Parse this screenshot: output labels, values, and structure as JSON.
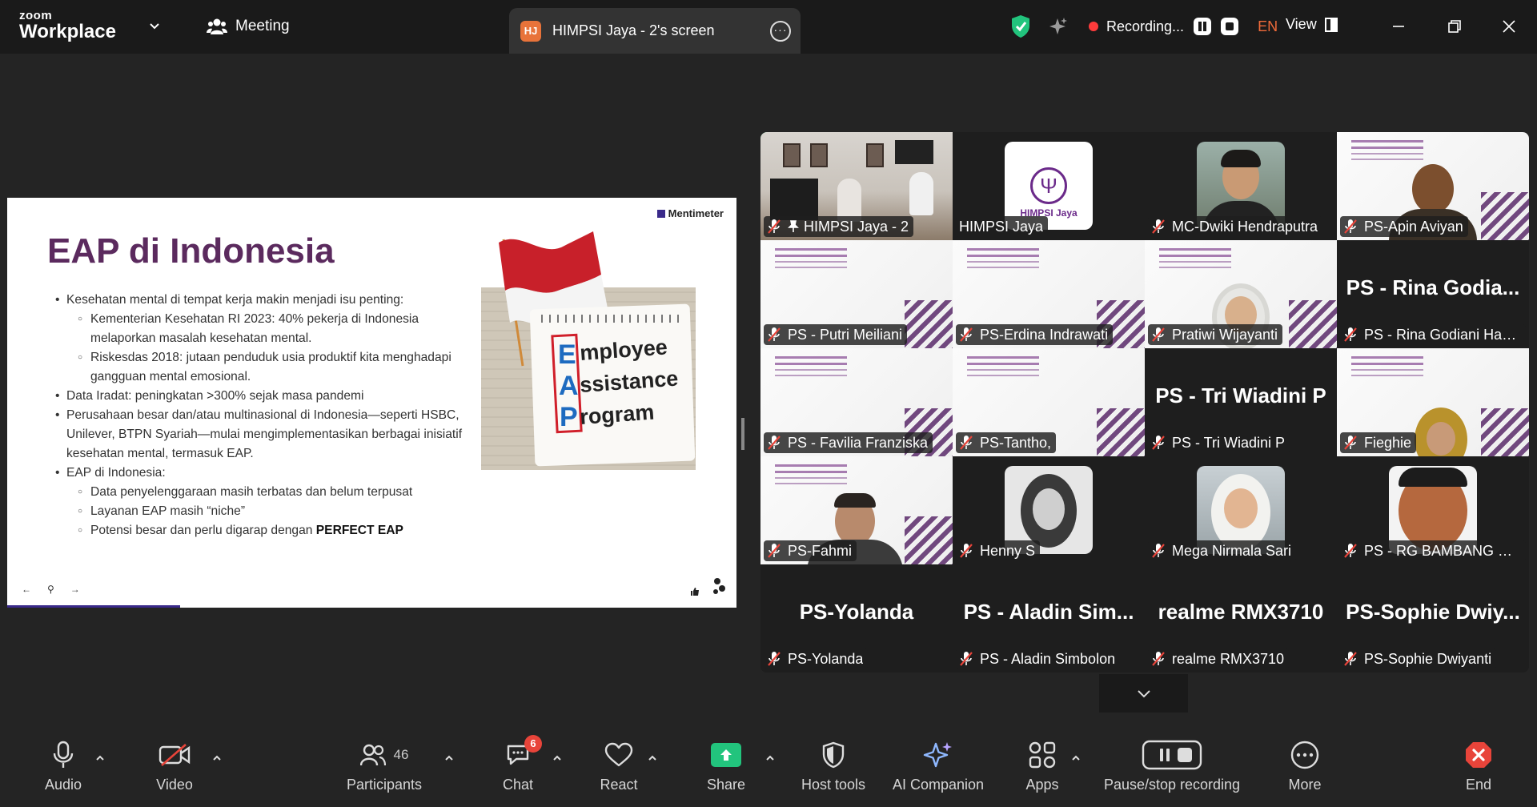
{
  "app": {
    "brand_small": "zoom",
    "brand_big": "Workplace"
  },
  "header": {
    "meeting_label": "Meeting",
    "tab_avatar": "HJ",
    "tab_title": "HIMPSI Jaya - 2's screen",
    "recording_label": "Recording...",
    "language": "EN",
    "view_label": "View"
  },
  "slide": {
    "brand": "Mentimeter",
    "title": "EAP di Indonesia",
    "bullets": {
      "b1": "Kesehatan mental di tempat kerja makin menjadi isu penting:",
      "b1a": "Kementerian Kesehatan RI 2023: 40% pekerja di Indonesia melaporkan masalah kesehatan mental.",
      "b1b": "Riskesdas 2018: jutaan penduduk usia produktif kita menghadapi gangguan mental emosional.",
      "b2": "Data Iradat: peningkatan >300% sejak masa pandemi",
      "b3": "Perusahaan besar dan/atau multinasional di Indonesia—seperti HSBC, Unilever, BTPN Syariah—mulai mengimplementasikan berbagai inisiatif kesehatan mental, termasuk EAP.",
      "b4": "EAP di Indonesia:",
      "b4a": "Data penyelenggaraan masih terbatas dan belum terpusat",
      "b4b": "Layanan EAP masih “niche”",
      "b4c_prefix": "Potensi besar dan perlu digarap dengan ",
      "b4c_bold": "PERFECT EAP"
    },
    "image_letters": {
      "e": "E",
      "a": "A",
      "p": "P"
    },
    "image_words": {
      "w1": "mployee",
      "w2": "ssistance",
      "w3": "rogram"
    }
  },
  "gallery": {
    "tiles": [
      {
        "name": "HIMPSI Jaya - 2"
      },
      {
        "name": "HIMPSI Jaya",
        "logo_text": "HIMPSI Jaya"
      },
      {
        "name": "MC-Dwiki Hendraputra"
      },
      {
        "name": "PS-Apin Aviyan"
      },
      {
        "name": "PS - Putri Meiliani"
      },
      {
        "name": "PS-Erdina Indrawati"
      },
      {
        "name": "Pratiwi Wijayanti"
      },
      {
        "name": "PS - Rina Godiani Haki...",
        "big": "PS - Rina Godia..."
      },
      {
        "name": "PS - Favilia Franziska"
      },
      {
        "name": "PS-Tantho,"
      },
      {
        "name": "PS - Tri Wiadini P",
        "big": "PS - Tri Wiadini P"
      },
      {
        "name": "Fieghie"
      },
      {
        "name": "PS-Fahmi"
      },
      {
        "name": "Henny S"
      },
      {
        "name": "Mega Nirmala Sari"
      },
      {
        "name": "PS - RG BAMBANG HA..."
      },
      {
        "name": "PS-Yolanda",
        "big": "PS-Yolanda"
      },
      {
        "name": "PS - Aladin Simbolon",
        "big": "PS - Aladin Sim..."
      },
      {
        "name": "realme RMX3710",
        "big": "realme RMX3710"
      },
      {
        "name": "PS-Sophie Dwiyanti",
        "big": "PS-Sophie  Dwiy..."
      }
    ]
  },
  "toolbar": {
    "audio": "Audio",
    "video": "Video",
    "participants": "Participants",
    "participants_count": "46",
    "chat": "Chat",
    "chat_badge": "6",
    "react": "React",
    "share": "Share",
    "host_tools": "Host tools",
    "ai_companion": "AI Companion",
    "apps": "Apps",
    "pause_stop": "Pause/stop recording",
    "more": "More",
    "end": "End"
  },
  "colors": {
    "accent_green": "#22c47d",
    "record_red": "#ff3b3b",
    "end_red": "#e8443a",
    "slide_title": "#5b2a5e"
  }
}
